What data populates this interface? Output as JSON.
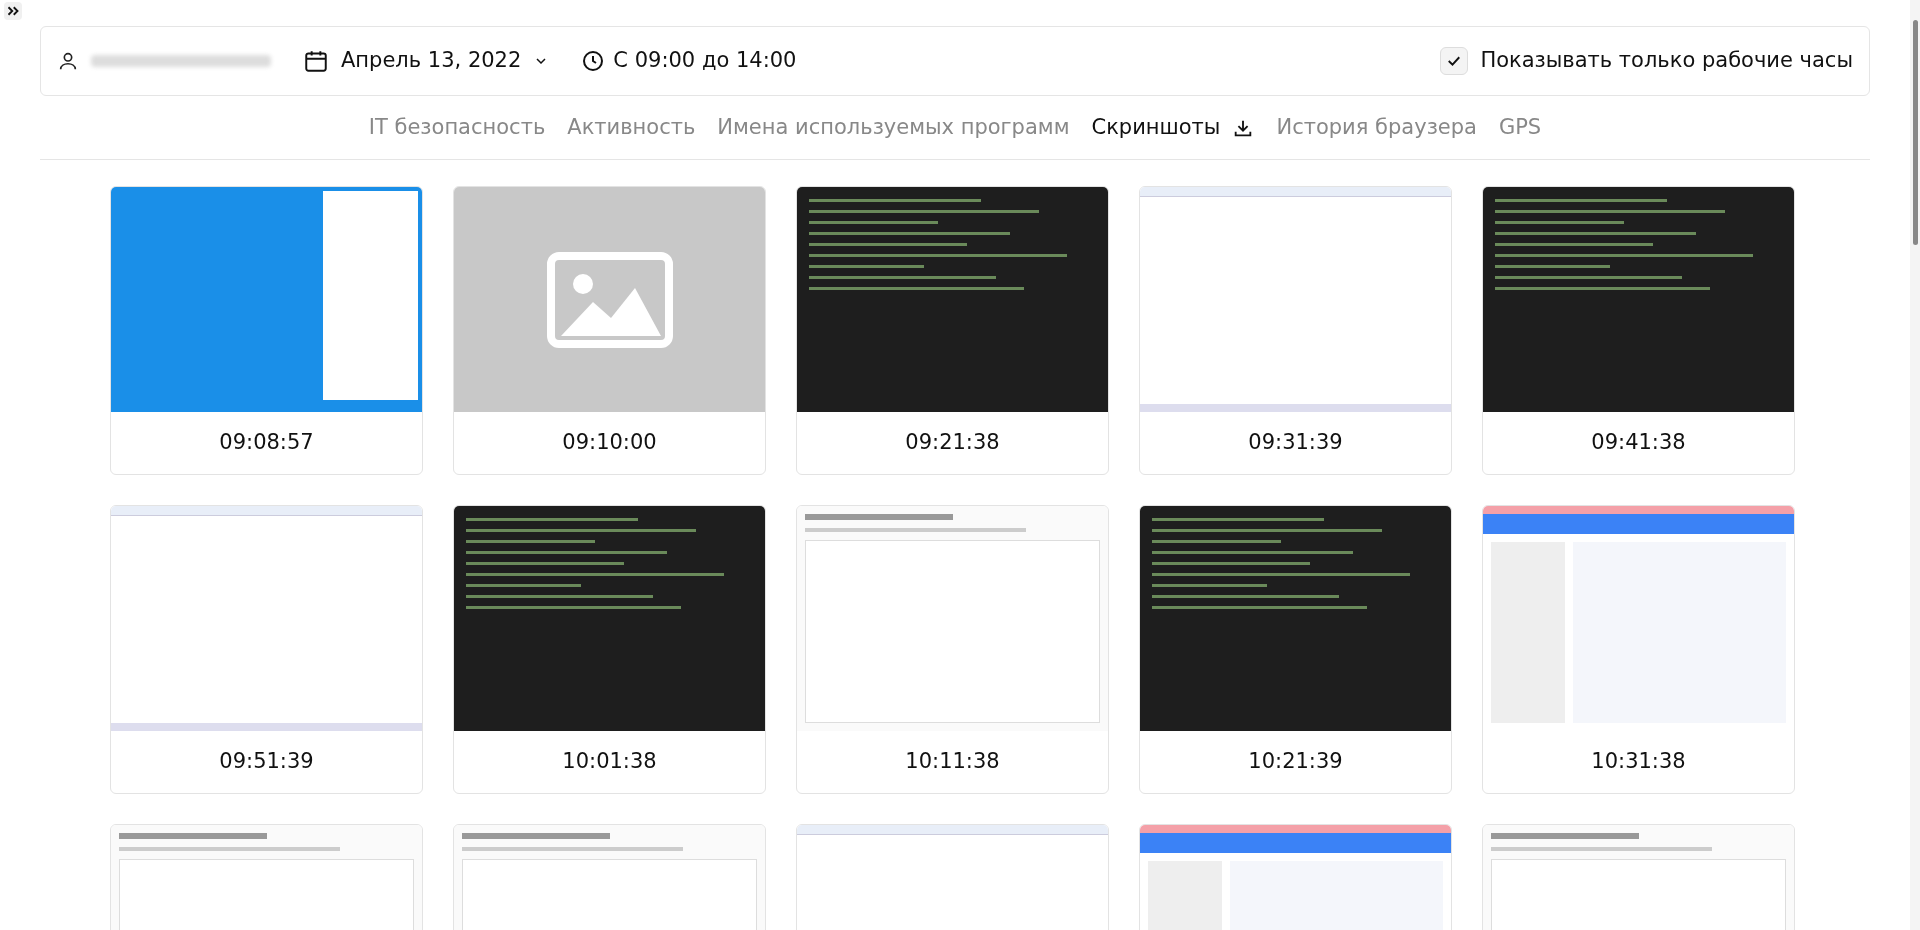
{
  "header": {
    "date": "Апрель 13, 2022",
    "time_range": "С 09:00 до 14:00",
    "working_hours": {
      "label": "Показывать только рабочие часы",
      "checked": true
    }
  },
  "tabs": [
    {
      "label": "IT безопасность",
      "selected": false,
      "download": false
    },
    {
      "label": "Активность",
      "selected": false,
      "download": false
    },
    {
      "label": "Имена используемых программ",
      "selected": false,
      "download": false
    },
    {
      "label": "Скриншоты",
      "selected": true,
      "download": true
    },
    {
      "label": "История браузера",
      "selected": false,
      "download": false
    },
    {
      "label": "GPS",
      "selected": false,
      "download": false
    }
  ],
  "screenshots": [
    {
      "kind": "desktop",
      "time": "09:08:57"
    },
    {
      "kind": "missing",
      "time": "09:10:00"
    },
    {
      "kind": "code",
      "time": "09:21:38"
    },
    {
      "kind": "browser",
      "time": "09:31:39"
    },
    {
      "kind": "code",
      "time": "09:41:38"
    },
    {
      "kind": "browser",
      "time": "09:51:39"
    },
    {
      "kind": "code",
      "time": "10:01:38"
    },
    {
      "kind": "dashboard",
      "time": "10:11:38"
    },
    {
      "kind": "code",
      "time": "10:21:39"
    },
    {
      "kind": "webpage",
      "time": "10:31:38"
    },
    {
      "kind": "dashboard"
    },
    {
      "kind": "dashboard"
    },
    {
      "kind": "browser"
    },
    {
      "kind": "webpage"
    },
    {
      "kind": "dashboard"
    }
  ]
}
